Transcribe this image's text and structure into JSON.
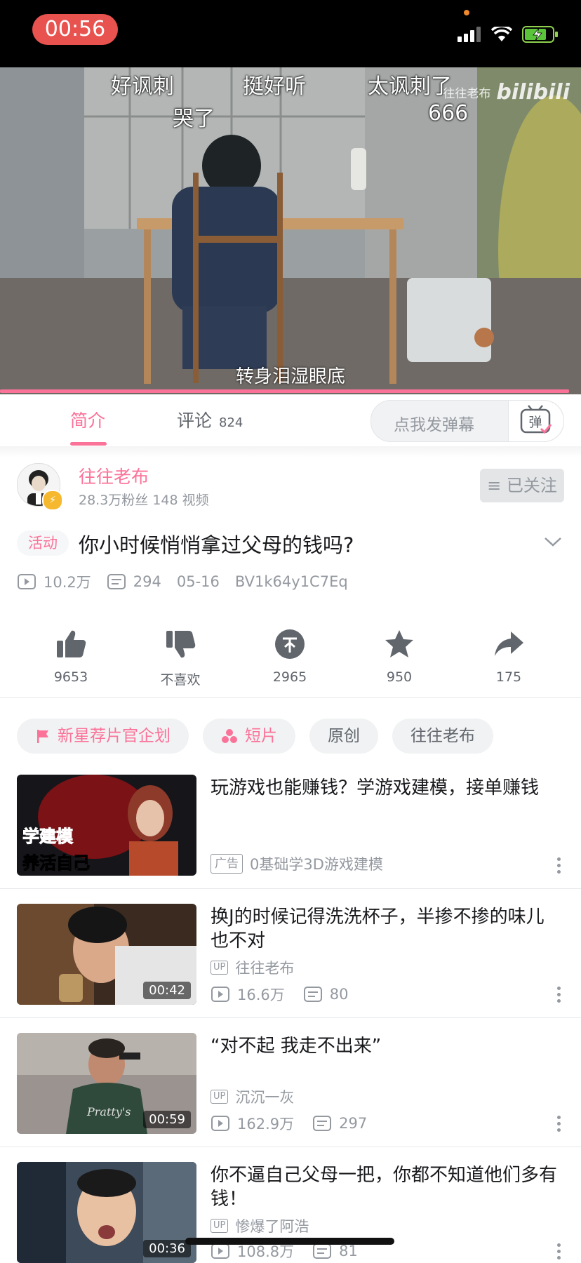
{
  "status": {
    "time": "00:56"
  },
  "video": {
    "danmaku": [
      "好讽刺",
      "挺好听",
      "太讽刺了",
      "哭了",
      "666"
    ],
    "subtitle": "转身泪湿眼底",
    "watermark_author": "往往老布",
    "watermark_logo": "bilibili",
    "progress_fraction": 0.98
  },
  "tabs": {
    "intro": "简介",
    "comments": "评论",
    "comment_count": "824",
    "danmu_placeholder": "点我发弹幕",
    "danmu_icon_char": "弹"
  },
  "author": {
    "name": "往往老布",
    "stats": "28.3万粉丝   148 视频",
    "follow_label": "≡ 已关注"
  },
  "video_info": {
    "activity_tag": "活动",
    "title": "你小时候悄悄拿过父母的钱吗?",
    "views": "10.2万",
    "danmaku_count": "294",
    "date": "05-16",
    "bvid": "BV1k64y1C7Eq"
  },
  "actions": {
    "like": "9653",
    "dislike": "不喜欢",
    "coin": "2965",
    "favorite": "950",
    "share": "175"
  },
  "tags": [
    "新星荐片官企划",
    "短片",
    "原创",
    "往往老布"
  ],
  "recommendations": [
    {
      "title": "玩游戏也能赚钱？学游戏建模，接单赚钱",
      "ad_label": "广告",
      "source": "0基础学3D游戏建模",
      "thumb_text_1": "学建模",
      "thumb_text_2": "养活自己"
    },
    {
      "title": "换J的时候记得洗洗杯子，半掺不掺的味儿也不对",
      "up_label": "UP",
      "uploader": "往往老布",
      "views": "16.6万",
      "danmaku": "80",
      "duration": "00:42"
    },
    {
      "title": "“对不起  我走不出来”",
      "up_label": "UP",
      "uploader": "沉沉一灰",
      "views": "162.9万",
      "danmaku": "297",
      "duration": "00:59"
    },
    {
      "title": "你不逼自己父母一把，你都不知道他们多有钱！",
      "up_label": "UP",
      "uploader": "惨爆了阿浩",
      "views": "108.8万",
      "danmaku": "81",
      "duration": "00:36"
    }
  ],
  "colors": {
    "accent": "#fb7299",
    "status_pill": "#e8534f",
    "muted": "#9499a0"
  }
}
